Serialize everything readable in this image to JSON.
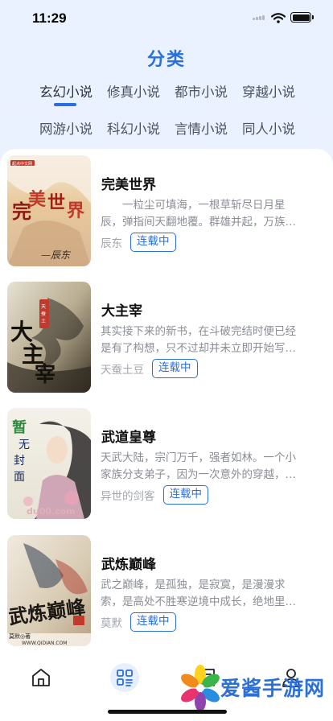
{
  "status_bar": {
    "time": "11:29"
  },
  "header": {
    "title": "分类"
  },
  "categories": [
    {
      "label": "玄幻小说",
      "active": true
    },
    {
      "label": "修真小说",
      "active": false
    },
    {
      "label": "都市小说",
      "active": false
    },
    {
      "label": "穿越小说",
      "active": false
    },
    {
      "label": "网游小说",
      "active": false
    },
    {
      "label": "科幻小说",
      "active": false
    },
    {
      "label": "言情小说",
      "active": false
    },
    {
      "label": "同人小说",
      "active": false
    }
  ],
  "books": [
    {
      "title": "完美世界",
      "desc_line1": "　　一粒尘可填海，一根草斩尽日月星",
      "desc_line2": "辰，弹指间天翻地覆。群雄并起，万族…",
      "author": "辰东",
      "status": "连载中",
      "cover_text": "完美世界",
      "cover_sub": "—辰东"
    },
    {
      "title": "大主宰",
      "desc_line1": "其实接下来的新书，在斗破完结时便已经",
      "desc_line2": "是有了构想，只不过却并未立即开始写…",
      "author": "天蚕土豆",
      "status": "连载中",
      "cover_text": "大主宰",
      "cover_sub": "天蚕土豆"
    },
    {
      "title": "武道皇尊",
      "desc_line1": "天武大陆，宗门万千，强者如林。一个小",
      "desc_line2": "家族分支弟子，因为一次意外的穿越，…",
      "author": "异世的剑客",
      "status": "连载中",
      "cover_text": "暂无封面",
      "cover_sub": "du00.com"
    },
    {
      "title": "武炼巅峰",
      "desc_line1": "武之巅峰，是孤独，是寂寞，是漫漫求",
      "desc_line2": "索，是高处不胜寒逆境中成长，绝地里…",
      "author": "莫默",
      "status": "连载中",
      "cover_text": "武炼巅峰",
      "cover_sub": "WWW.QIDIAN.COM"
    }
  ],
  "tabbar": [
    {
      "icon": "home-icon",
      "active": false
    },
    {
      "icon": "category-icon",
      "active": true
    },
    {
      "icon": "bookmark-icon",
      "active": false
    },
    {
      "icon": "profile-icon",
      "active": false
    }
  ],
  "watermark": {
    "text": "爱酱手游网"
  },
  "colors": {
    "accent": "#2a6fdc",
    "muted": "#8a8d94",
    "background": "#eaf1ff"
  }
}
